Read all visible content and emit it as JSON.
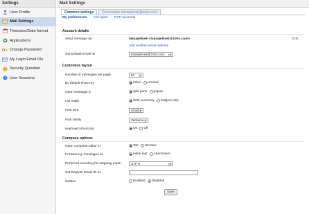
{
  "sidebar": {
    "title": "Settings",
    "items": [
      {
        "label": "User Profile",
        "icon": "user-icon"
      },
      {
        "label": "Mail Settings",
        "icon": "mail-icon"
      },
      {
        "label": "Timezone/Date format",
        "icon": "calendar-icon"
      },
      {
        "label": "Applications",
        "icon": "applications-icon"
      },
      {
        "label": "Change Password",
        "icon": "key-icon"
      },
      {
        "label": "My Login Email IDs",
        "icon": "email-id-icon"
      },
      {
        "label": "Security Question",
        "icon": "question-icon"
      },
      {
        "label": "User Sessions",
        "icon": "sessions-icon"
      }
    ]
  },
  "main": {
    "title": "Mail Settings",
    "tabs": [
      "Common settings",
      "Personalize lukasjelinek@zoho.com"
    ],
    "subtabs": [
      "My preferences",
      "Anti-spam",
      "POP accounts"
    ]
  },
  "account": {
    "heading": "Account details",
    "send_as_label": "Send message as:",
    "send_as_value": "lukasjelinek <lukasjelinek@zoho.com>",
    "edit": "Edit",
    "add_email": "Add another email address",
    "default_label": "Set Default Email ID",
    "default_value": "lukasjelinek@zoho.com"
  },
  "layout": {
    "heading": "Customize layout",
    "per_page_label": "Number of messages per page",
    "per_page_value": "50",
    "show_label": "By default show my",
    "show_opts": [
      "Inbox",
      "Unread"
    ],
    "open_label": "Open message in",
    "open_opts": [
      "split pane",
      "popup"
    ],
    "list_label": "List mails",
    "list_opts": [
      "With summary",
      "Subject only"
    ],
    "font_size_label": "Font size",
    "font_size_value": "Small",
    "font_family_label": "Font family",
    "font_family_value": "Verdana",
    "shortcuts_label": "Keyboard shortcuts",
    "shortcuts_opts": [
      "On",
      "Off"
    ]
  },
  "compose": {
    "heading": "Compose options",
    "editor_label": "Open compose editor in",
    "editor_opts": [
      "Tab",
      "Window"
    ],
    "forward_label": "Forward my messages as",
    "forward_opts": [
      "Inline text",
      "Attachment"
    ],
    "encoding_label": "Preferred encoding for outgoing mails",
    "encoding_value": "UTF-8",
    "replyto_label": "Set ReplyTo Email ID as",
    "replyto_value": "",
    "outbox_label": "Outbox",
    "outbox_opts": [
      "Enabled",
      "Disabled"
    ]
  },
  "save_label": "Save"
}
